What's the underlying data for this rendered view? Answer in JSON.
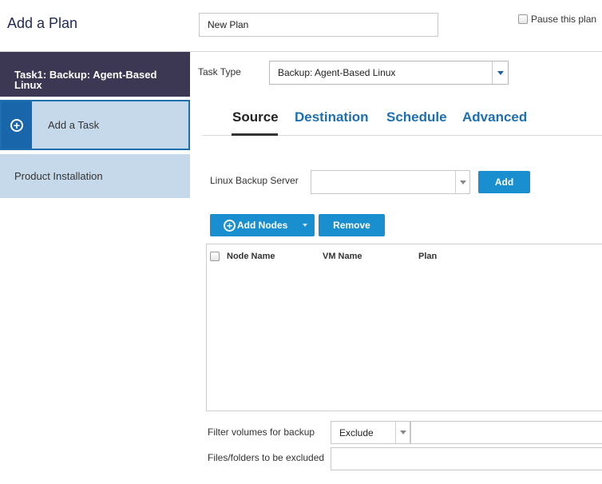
{
  "header": {
    "title": "Add a Plan",
    "plan_name_value": "New Plan",
    "pause_label": "Pause this plan"
  },
  "sidebar": {
    "items": [
      {
        "label": "Task1: Backup: Agent-Based Linux"
      },
      {
        "label": "Add a Task",
        "icon": "plus-circle-icon"
      },
      {
        "label": "Product Installation"
      }
    ]
  },
  "task_type": {
    "label": "Task Type",
    "value": "Backup: Agent-Based Linux"
  },
  "tabs": [
    {
      "label": "Source",
      "active": true
    },
    {
      "label": "Destination"
    },
    {
      "label": "Schedule"
    },
    {
      "label": "Advanced"
    }
  ],
  "source": {
    "linux_backup_server_label": "Linux Backup Server",
    "linux_backup_server_value": "",
    "add_label": "Add",
    "add_nodes_label": "Add Nodes",
    "remove_label": "Remove",
    "grid_columns": [
      "Node Name",
      "VM Name",
      "Plan"
    ],
    "filter_label": "Filter volumes for backup",
    "filter_mode": "Exclude",
    "filter_value": "",
    "files_excluded_label": "Files/folders to be excluded",
    "files_excluded_value": ""
  },
  "colors": {
    "accent": "#1a8fcf",
    "tab_link": "#1e6fb0",
    "sidebar_active": "#3c3753",
    "sidebar_item": "#c6d9ea"
  }
}
